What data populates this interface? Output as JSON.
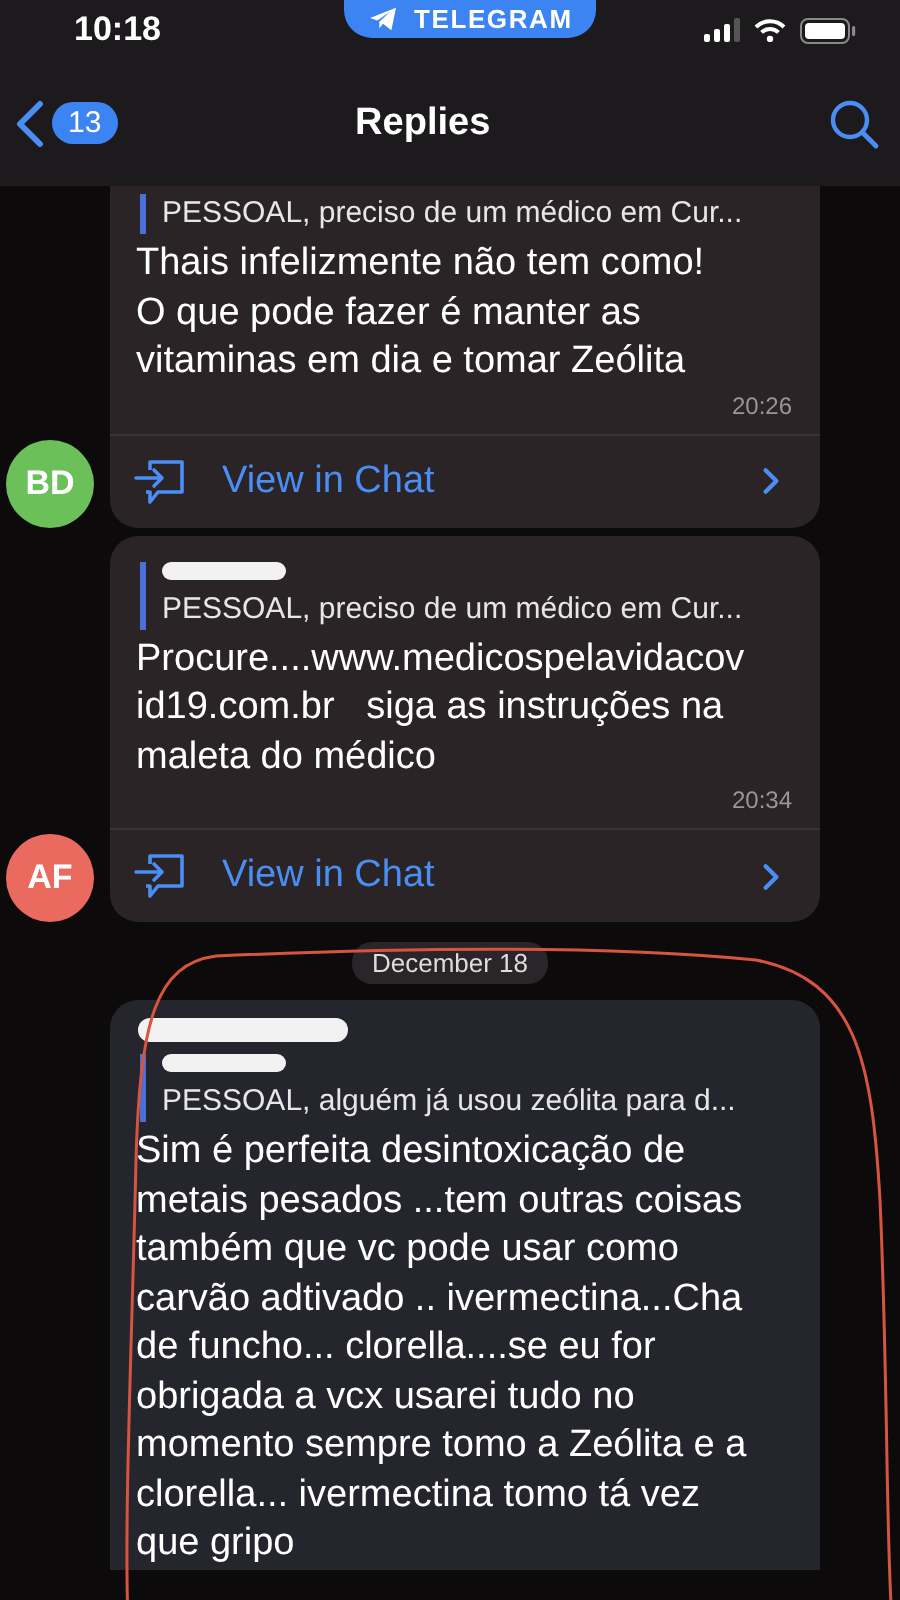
{
  "status_bar": {
    "time": "10:18",
    "pill": "TELEGRAM"
  },
  "nav": {
    "back_count": "13",
    "title": "Replies"
  },
  "messages": [
    {
      "kind": "reply",
      "avatar": "BD",
      "color": "#6cc05a",
      "quote_text": "PESSOAL, preciso de um médico em Cur...",
      "text": "Thais infelizmente não tem como!\nO que pode fazer é manter as vitaminas em dia e tomar Zeólita",
      "time": "20:26",
      "link": "View in Chat"
    },
    {
      "kind": "reply",
      "avatar": "AF",
      "color": "#ea6a5f",
      "quote_author_redacted": true,
      "quote_text": "PESSOAL, preciso de um médico em Cur...",
      "text": "Procure....www.medicospelavidacov id19.com.br   siga as instruções na maleta do médico",
      "time": "20:34",
      "link": "View in Chat"
    },
    {
      "kind": "date",
      "text": "December 18"
    },
    {
      "kind": "reply",
      "sender_redacted": true,
      "quote_author_redacted": true,
      "quote_text": "PESSOAL, alguém já usou zeólita para d...",
      "text": "Sim é perfeita desintoxicação de metais pesados ...tem outras coisas também que vc pode usar como carvão adtivado .. ivermectina...Cha de funcho... clorella....se eu for obrigada a vcx usarei tudo no momento sempre tomo a Zeólita e a clorella... ivermectina tomo tá vez que gripo",
      "outlined": true
    }
  ]
}
